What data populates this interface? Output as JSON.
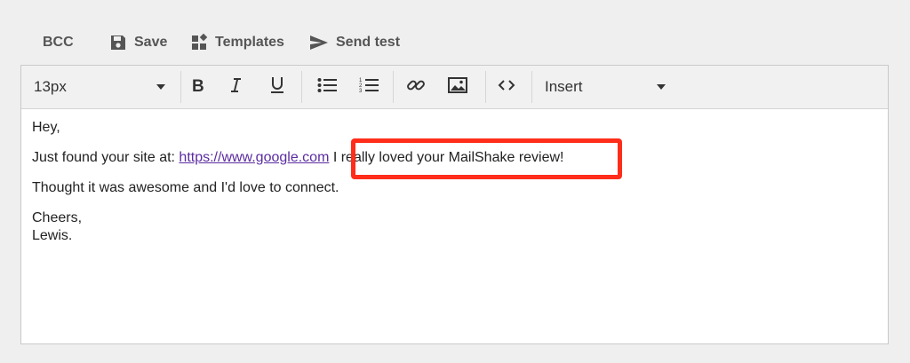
{
  "top_actions": {
    "bcc": "BCC",
    "save": "Save",
    "templates": "Templates",
    "send_test": "Send test"
  },
  "toolbar": {
    "font_size": "13px",
    "insert": "Insert",
    "icons": [
      "bold-icon",
      "italic-icon",
      "underline-icon",
      "bulleted-list-icon",
      "numbered-list-icon",
      "link-icon",
      "image-icon",
      "code-icon"
    ]
  },
  "email_body": {
    "greeting": "Hey,",
    "line1_prefix": "Just found your site at: ",
    "line1_link": "https://www.google.com",
    "line1_suffix": " I really loved your MailShake review!",
    "line2": "Thought it was awesome and I'd love to connect.",
    "signoff": "Cheers,",
    "name": "Lewis."
  },
  "colors": {
    "highlight": "#ff2d1a",
    "link": "#5b2ca0"
  }
}
